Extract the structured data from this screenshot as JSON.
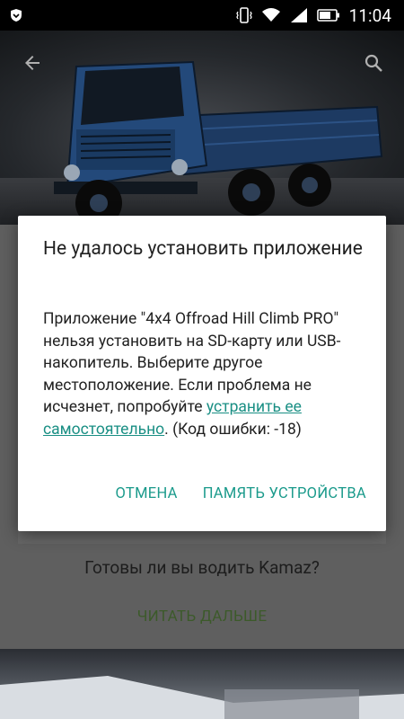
{
  "status_bar": {
    "time": "11:04",
    "icons": [
      "notification-shield-icon",
      "vibrate-icon",
      "wifi-icon",
      "signal-icon",
      "battery-icon"
    ]
  },
  "header": {
    "back_icon": "arrow-back-icon",
    "search_icon": "search-icon"
  },
  "page": {
    "tagline": "Готовы ли вы водить Kamaz?",
    "read_more": "ЧИТАТЬ ДАЛЬШЕ"
  },
  "dialog": {
    "title": "Не удалось установить приложение",
    "body_part1": "Приложение \"4x4 Offroad Hill Climb PRO\" нельзя установить на SD-карту или USB-накопитель. Выберите другое местоположение. Если проблема не исчезнет, попробуйте ",
    "body_link": "устранить ее самостоятельно",
    "body_part2": ". (Код ошибки: -18)",
    "cancel_label": "ОТМЕНА",
    "device_memory_label": "ПАМЯТЬ УСТРОЙСТВА"
  },
  "colors": {
    "accent": "#1a9a8b",
    "link": "#1a8f84",
    "read_more": "#3c5a2a",
    "scrim_bg": "#5f5f5f"
  }
}
